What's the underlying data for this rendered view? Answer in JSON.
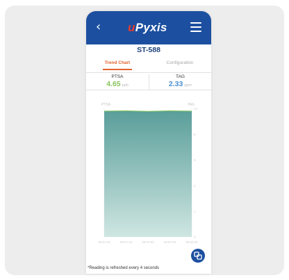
{
  "app": {
    "logo_prefix": "u",
    "logo_main": "Pyxis",
    "device_id": "ST-588"
  },
  "tabs": {
    "trend": "Trend Chart",
    "config": "Configuration"
  },
  "readings": {
    "left": {
      "name": "PTSA",
      "value": "4.65",
      "unit": "ppb"
    },
    "right": {
      "name": "TAG",
      "value": "2.33",
      "unit": "ppm"
    }
  },
  "footnote": "*Reading is refreshed every 4 seconds",
  "icons": {
    "back": "chevron-left-icon",
    "menu": "hamburger-menu-icon",
    "fab": "fullscreen-icon"
  },
  "colors": {
    "brand_blue": "#1c4fa0",
    "accent_orange": "#e3622d",
    "ptsa_green": "#86c45a",
    "tag_blue": "#4b90d2",
    "area_top": "#5a9e9a",
    "area_bottom": "#cfe6e2"
  },
  "chart_data": {
    "type": "area",
    "left_axis_label": "PTSA",
    "right_axis_label": "TAG",
    "x": [
      "09:57:30",
      "09:57:40",
      "09:57:50",
      "09:57:60",
      "09:58:00"
    ],
    "series": [
      {
        "name": "PTSA",
        "values": [
          4.65,
          4.66,
          4.64,
          4.66,
          4.65
        ]
      },
      {
        "name": "TAG",
        "values": [
          2.33,
          2.33,
          2.33,
          2.33,
          2.33
        ]
      }
    ],
    "right_ticks": [
      "10",
      "8",
      "6",
      "4",
      "2",
      "0"
    ],
    "grid": false,
    "legend": "none"
  }
}
